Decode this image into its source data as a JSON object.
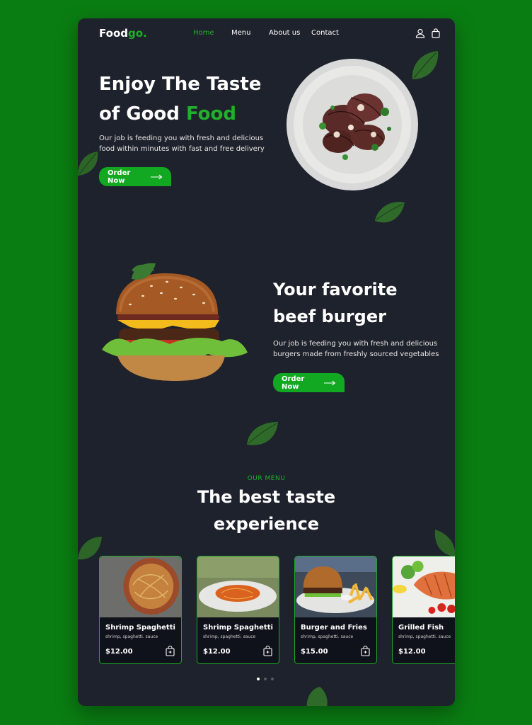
{
  "brand": {
    "name_main": "Food",
    "name_accent": "go."
  },
  "nav": {
    "items": [
      {
        "label": "Home",
        "active": true
      },
      {
        "label": "Menu",
        "active": false
      },
      {
        "label": "About us",
        "active": false
      },
      {
        "label": "Contact",
        "active": false
      }
    ]
  },
  "header_icons": [
    "user-icon",
    "shopping-bag-icon"
  ],
  "hero": {
    "title_line1": "Enjoy The Taste",
    "title_line2_prefix": "of Good ",
    "title_line2_accent": "Food",
    "description": "Our job is feeding you with fresh and delicious food within minutes with fast and free delivery",
    "cta_label": "Order Now"
  },
  "feature": {
    "title": "Your favorite beef burger",
    "description": "Our job is feeding you with fresh and delicious burgers made from freshly sourced vegetables",
    "cta_label": "Order Now"
  },
  "menu": {
    "kicker": "OUR MENU",
    "title": "The best taste experience",
    "cards": [
      {
        "name": "Shrimp Spaghetti",
        "subtitle": "shrimp, spaghetti. sauce",
        "price": "$12.00"
      },
      {
        "name": "Shrimp Spaghetti",
        "subtitle": "shrimp, spaghetti. sauce",
        "price": "$12.00"
      },
      {
        "name": "Burger and Fries",
        "subtitle": "shrimp, spaghetti. sauce",
        "price": "$15.00"
      },
      {
        "name": "Grilled Fish",
        "subtitle": "shrimp, spaghetti. sauce",
        "price": "$12.00"
      }
    ],
    "carousel_active_index": 0,
    "carousel_count": 3
  },
  "colors": {
    "accent": "#21b02b",
    "background": "#1e222c",
    "page": "#0a7d12"
  }
}
